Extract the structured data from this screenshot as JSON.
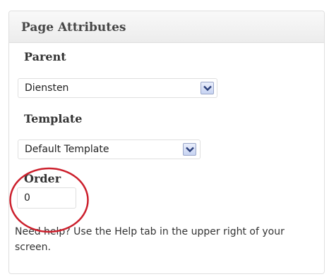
{
  "panel": {
    "title": "Page Attributes",
    "parent": {
      "label": "Parent",
      "selected": "Diensten"
    },
    "template": {
      "label": "Template",
      "selected": "Default Template"
    },
    "order": {
      "label": "Order",
      "value": "0"
    },
    "help_text": "Need help? Use the Help tab in the upper right of your screen."
  },
  "icons": {
    "dropdown": "chevron-down-icon",
    "annotation": "red-circle-annotation"
  },
  "colors": {
    "annotation_circle": "#cc1f2c",
    "dropdown_button": "#c7d3f2"
  }
}
